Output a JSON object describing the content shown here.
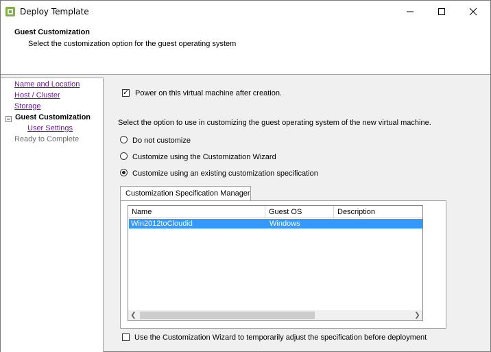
{
  "window": {
    "title": "Deploy Template",
    "controls": {
      "minimize": "minimize",
      "maximize": "maximize",
      "close": "close"
    }
  },
  "header": {
    "title": "Guest Customization",
    "subtitle": "Select the customization option for the guest operating system"
  },
  "nav": {
    "items": [
      {
        "label": "Name and Location",
        "state": "link"
      },
      {
        "label": "Host / Cluster",
        "state": "link"
      },
      {
        "label": "Storage",
        "state": "link"
      },
      {
        "label": "Guest Customization",
        "state": "current"
      },
      {
        "label": "User Settings",
        "state": "link"
      },
      {
        "label": "Ready to Complete",
        "state": "disabled"
      }
    ]
  },
  "main": {
    "power_on": {
      "label": "Power on this virtual machine after creation.",
      "checked": true
    },
    "prompt": "Select the option to use in customizing the guest operating system of the new virtual machine.",
    "options": [
      {
        "label": "Do not customize",
        "selected": false
      },
      {
        "label": "Customize using the Customization Wizard",
        "selected": false
      },
      {
        "label": "Customize using an existing customization specification",
        "selected": true
      }
    ],
    "tab_label": "Customization Specification Manager",
    "table": {
      "columns": [
        "Name",
        "Guest OS",
        "Description"
      ],
      "rows": [
        {
          "name": "Win2012toCloudid",
          "guest_os": "Windows",
          "description": "",
          "selected": true
        }
      ]
    },
    "wizard_adjust": {
      "label": "Use the Customization Wizard to temporarily adjust the specification before deployment",
      "checked": false
    }
  },
  "colors": {
    "selection": "#3399ff",
    "link": "#6a1b9a",
    "disabled_text": "#6d6d6d"
  }
}
